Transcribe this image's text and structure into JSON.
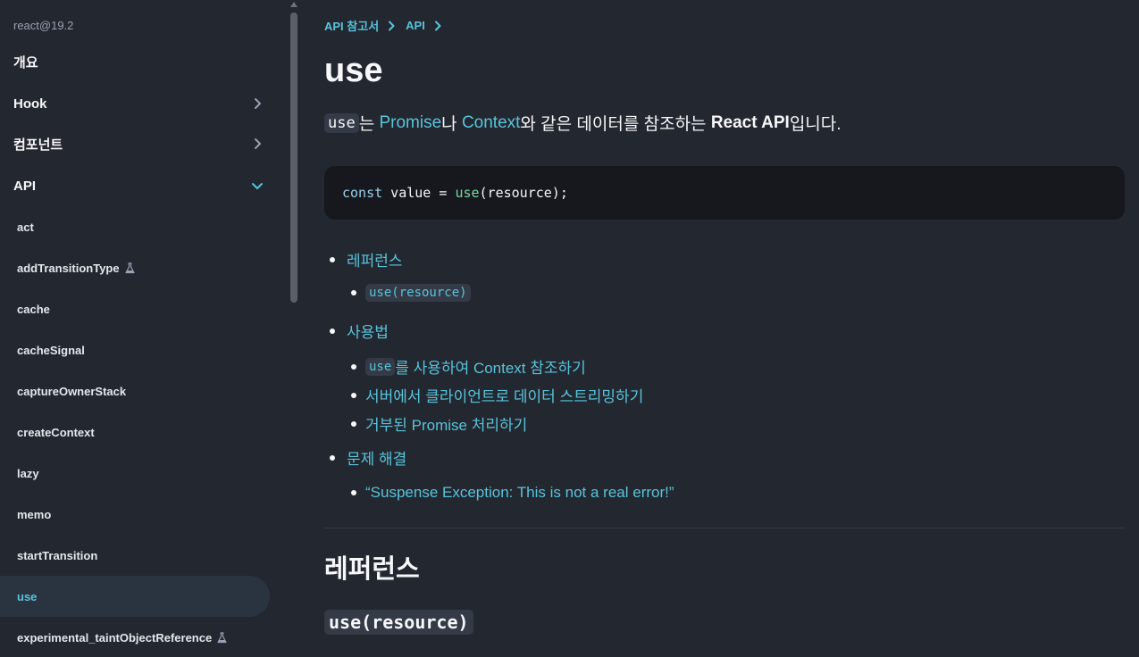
{
  "sidebar": {
    "version": "react@19.2",
    "sections": [
      {
        "label": "개요"
      },
      {
        "label": "Hook"
      },
      {
        "label": "컴포넌트"
      },
      {
        "label": "API"
      }
    ],
    "items": [
      {
        "label": "act"
      },
      {
        "label": "addTransitionType"
      },
      {
        "label": "cache"
      },
      {
        "label": "cacheSignal"
      },
      {
        "label": "captureOwnerStack"
      },
      {
        "label": "createContext"
      },
      {
        "label": "lazy"
      },
      {
        "label": "memo"
      },
      {
        "label": "startTransition"
      },
      {
        "label": "use"
      },
      {
        "label": "experimental_taintObjectReference"
      }
    ],
    "active_item": "use"
  },
  "breadcrumb": [
    "API 참고서",
    "API"
  ],
  "page": {
    "title": "use",
    "intro": {
      "code": "use",
      "t1": "는 ",
      "link1": "Promise",
      "t2": "나 ",
      "link2": "Context",
      "t3": "와 같은 데이터를 참조하는 ",
      "strong": "React API",
      "t4": "입니다."
    },
    "code_snippet": {
      "kw": "const",
      "var": " value ",
      "eq": "= ",
      "fn": "use",
      "rest": "(resource);"
    },
    "toc": {
      "reference": "레퍼런스",
      "reference_sub": "use(resource)",
      "usage": "사용법",
      "usage_sub1_code": "use",
      "usage_sub1_text": "를 사용하여 Context 참조하기",
      "usage_sub2": "서버에서 클라이언트로 데이터 스트리밍하기",
      "usage_sub3": "거부된 Promise 처리하기",
      "troubleshooting": "문제 해결",
      "troubleshooting_sub": "“Suspense Exception: This is not a real error!”"
    },
    "section_heading": "레퍼런스",
    "sub_heading": "use(resource)"
  },
  "colors": {
    "background": "#23272f",
    "link": "#58c4dc",
    "code_bg": "#16181d",
    "active_bg": "#2a3441"
  }
}
